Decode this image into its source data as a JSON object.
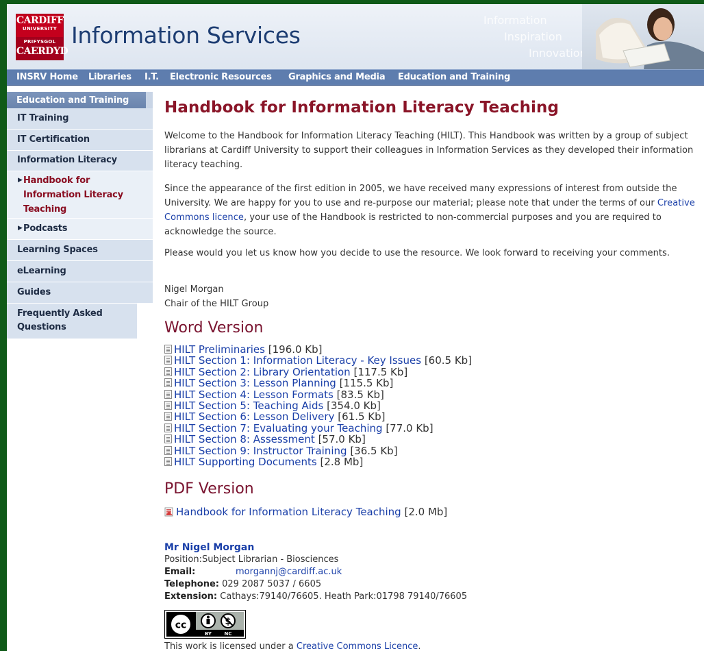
{
  "logo": {
    "line1": "CARDIFF",
    "line2": "UNIVERSITY",
    "line3": "PRIFYSGOL",
    "line4": "CAERDYD"
  },
  "header": {
    "title": "Information Services",
    "tagline": [
      "Information",
      "Inspiration",
      "Innovation"
    ]
  },
  "topnav": [
    "INSRV Home",
    "Libraries",
    "I.T.",
    "Electronic Resources",
    "Graphics and Media",
    "Education and Training"
  ],
  "sidebar": {
    "heading": "Education and Training",
    "items": [
      "IT Training",
      "IT Certification",
      "Information Literacy"
    ],
    "sub_items": [
      "Handbook for Information Literacy Teaching",
      "Podcasts"
    ],
    "more_items": [
      "Learning Spaces",
      "eLearning",
      "Guides",
      "Frequently Asked Questions"
    ]
  },
  "main": {
    "title": "Handbook for Information Literacy Teaching",
    "intro": "Welcome to the Handbook for Information Literacy Teaching (HILT). This Handbook was written by a group of subject librarians at Cardiff University to support their colleagues in Information Services as they developed their information literacy teaching.",
    "para2_before": "Since the appearance of the first edition in 2005, we have received many expressions of interest from outside the University. We are happy for you to use and re-purpose our material; please note that under the terms of our ",
    "para2_link": "Creative Commons licence",
    "para2_after": ", your use of the Handbook is restricted to non-commercial purposes and you are required to acknowledge the source.",
    "para3": "Please would you let us know how you decide to use the resource. We look forward to receiving your comments.",
    "signoff_name": "Nigel Morgan",
    "signoff_role": "Chair of the HILT Group",
    "word_heading": "Word Version",
    "word_docs": [
      {
        "title": "HILT Preliminaries",
        "size": "[196.0 Kb]"
      },
      {
        "title": "HILT Section 1: Information Literacy - Key Issues",
        "size": "[60.5 Kb]"
      },
      {
        "title": "HILT Section 2: Library Orientation",
        "size": "[117.5 Kb]"
      },
      {
        "title": "HILT Section 3: Lesson Planning",
        "size": "[115.5 Kb]"
      },
      {
        "title": "HILT Section 4: Lesson Formats",
        "size": "[83.5 Kb]"
      },
      {
        "title": "HILT Section 5: Teaching Aids",
        "size": "[354.0 Kb]"
      },
      {
        "title": "HILT Section 6: Lesson Delivery",
        "size": "[61.5 Kb]"
      },
      {
        "title": "HILT Section 7: Evaluating your Teaching",
        "size": "[77.0 Kb]"
      },
      {
        "title": "HILT Section 8: Assessment",
        "size": "[57.0 Kb]"
      },
      {
        "title": "HILT Section 9: Instructor Training",
        "size": "[36.5 Kb]"
      },
      {
        "title": "HILT Supporting Documents",
        "size": "[2.8 Mb]"
      }
    ],
    "pdf_heading": "PDF Version",
    "pdf_doc": {
      "title": "Handbook for Information Literacy Teaching",
      "size": "[2.0 Mb]"
    }
  },
  "contact": {
    "name": "Mr Nigel Morgan",
    "position": "Position:Subject Librarian - Biosciences",
    "email_label": "Email:",
    "email": "morgannj@cardiff.ac.uk",
    "phone_label": "Telephone:",
    "phone": "029 2087 5037 / 6605",
    "ext_label": "Extension:",
    "ext": "Cathays:79140/76605. Heath Park:01798 79140/76605"
  },
  "license": {
    "badge_by": "BY",
    "badge_nc": "NC",
    "text_before": "This work is licensed under a ",
    "link": "Creative Commons Licence",
    "text_after": "."
  },
  "colors": {
    "page_bg": "#0f5a18",
    "nav_bar": "#5e7dae",
    "sidebar_bg": "#d7e1ee",
    "title_red": "#8a1528",
    "link_blue": "#1a3fa8"
  }
}
